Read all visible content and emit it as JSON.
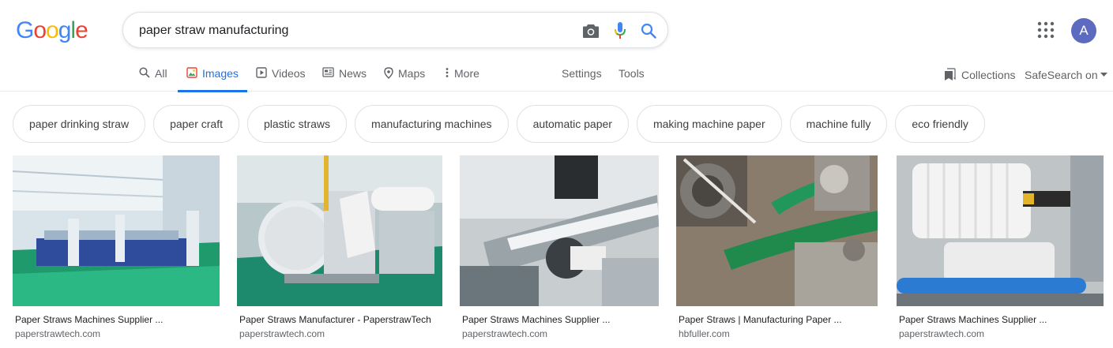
{
  "logo": {
    "text": "Google",
    "letters": [
      {
        "ch": "G",
        "color": "#4285F4"
      },
      {
        "ch": "o",
        "color": "#EA4335"
      },
      {
        "ch": "o",
        "color": "#FBBC05"
      },
      {
        "ch": "g",
        "color": "#4285F4"
      },
      {
        "ch": "l",
        "color": "#34A853"
      },
      {
        "ch": "e",
        "color": "#EA4335"
      }
    ]
  },
  "search": {
    "value": "paper straw manufacturing"
  },
  "icons": {
    "camera": "camera-icon",
    "mic": "microphone-icon",
    "search": "search-icon",
    "apps": "apps-grid-icon"
  },
  "account": {
    "initial": "A",
    "color": "#5c6bc0"
  },
  "tabs": [
    {
      "label": "All",
      "icon": "search-icon"
    },
    {
      "label": "Images",
      "icon": "image-icon",
      "active": true
    },
    {
      "label": "Videos",
      "icon": "play-icon"
    },
    {
      "label": "News",
      "icon": "newspaper-icon"
    },
    {
      "label": "Maps",
      "icon": "map-pin-icon"
    },
    {
      "label": "More",
      "icon": "more-vertical-icon"
    }
  ],
  "nav_links": {
    "settings": "Settings",
    "tools": "Tools",
    "collections": "Collections",
    "safesearch": "SafeSearch on"
  },
  "chips": [
    "paper drinking straw",
    "paper craft",
    "plastic straws",
    "manufacturing machines",
    "automatic paper",
    "making machine paper",
    "machine fully",
    "eco friendly"
  ],
  "results": [
    {
      "title": "Paper Straws Machines Supplier ...",
      "site": "paperstrawtech.com"
    },
    {
      "title": "Paper Straws Manufacturer - PaperstrawTech",
      "site": "paperstrawtech.com"
    },
    {
      "title": "Paper Straws Machines Supplier ...",
      "site": "paperstrawtech.com"
    },
    {
      "title": "Paper Straws | Manufacturing Paper ...",
      "site": "hbfuller.com"
    },
    {
      "title": "Paper Straws Machines Supplier ...",
      "site": "paperstrawtech.com"
    }
  ],
  "colors": {
    "accent": "#1a73e8",
    "text": "#202124",
    "muted": "#5f6368"
  }
}
